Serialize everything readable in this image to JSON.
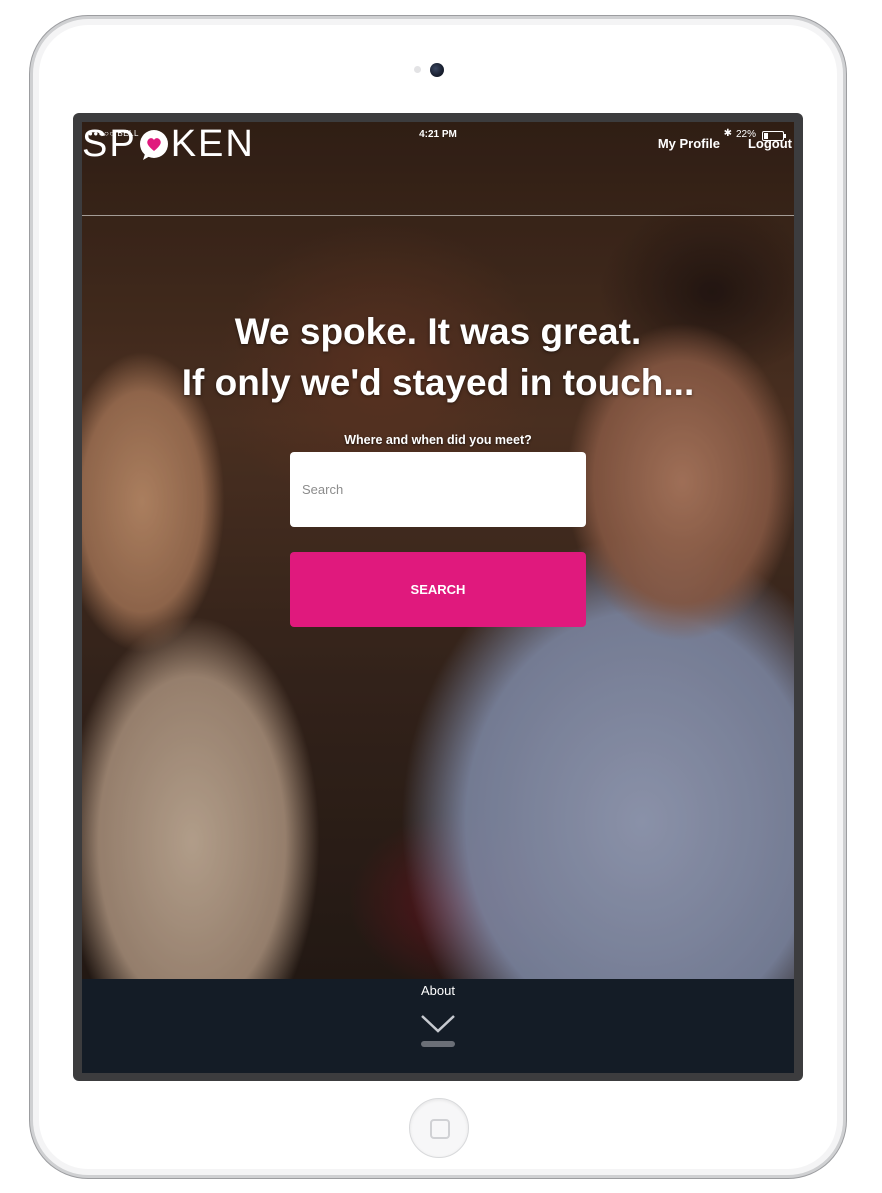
{
  "status_bar": {
    "carrier": "●●●○○ BELL",
    "time": "4:21 PM",
    "bluetooth": "✱",
    "battery_pct": "22%",
    "battery_level": 0.22
  },
  "header": {
    "logo_text_left": "SP",
    "logo_text_right": "KEN",
    "nav": [
      {
        "label": "My Profile"
      },
      {
        "label": "Logout"
      }
    ]
  },
  "hero": {
    "headline_line1": "We spoke. It was great.",
    "headline_line2": "If only we'd stayed in touch...",
    "prompt": "Where and when did you meet?",
    "search_placeholder": "Search",
    "search_value": "",
    "search_button": "SEARCH"
  },
  "footer": {
    "about_label": "About",
    "scroll_icon": "chevron-down-icon"
  },
  "colors": {
    "accent": "#e0197d",
    "footer_bg": "#141c26"
  }
}
